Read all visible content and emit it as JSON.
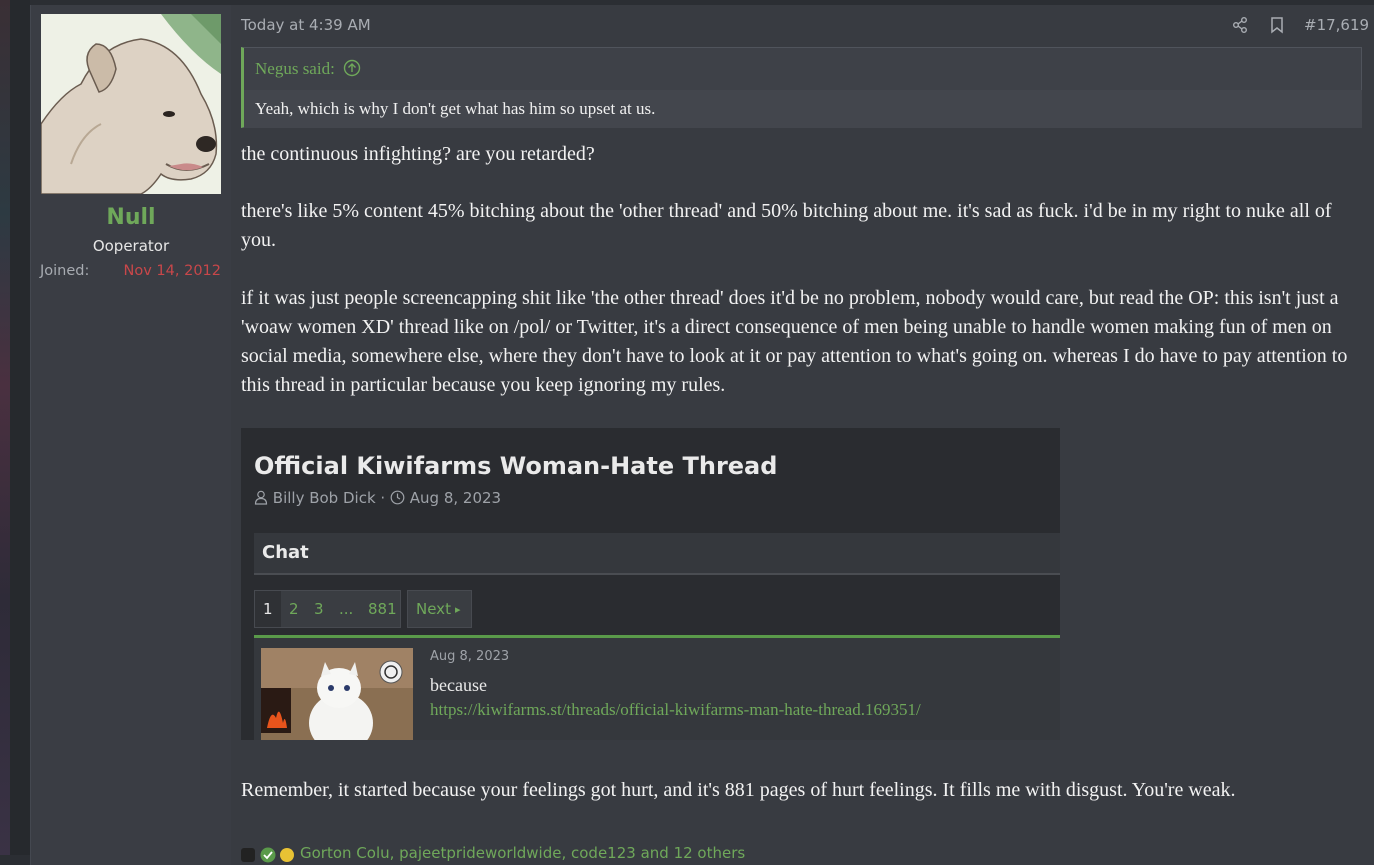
{
  "user": {
    "name": "Null",
    "title": "Ooperator",
    "joined_label": "Joined:",
    "joined_value": "Nov 14, 2012"
  },
  "post": {
    "date": "Today at 4:39 AM",
    "number": "#17,619",
    "quote": {
      "author": "Negus said:",
      "text": "Yeah, which is why I don't get what has him so upset at us."
    },
    "paragraphs": [
      "the continuous infighting? are you retarded?",
      "there's like 5% content 45% bitching about the 'other thread' and 50% bitching about me. it's sad as fuck. i'd be in my right to nuke all of you.",
      "if it was just people screencapping shit like 'the other thread' does it'd be no problem, nobody would care, but read the OP: this isn't just a 'woaw women XD' thread like on /pol/ or Twitter, it's a direct consequence of men being unable to handle women making fun of men on social media, somewhere else, where they don't have to look at it or pay attention to what's going on. whereas I do have to pay attention to this thread in particular because you keep ignoring my rules.",
      "Remember, it started because your feelings got hurt, and it's 881 pages of hurt feelings. It fills me with disgust. You're weak."
    ],
    "reactions_text": "Gorton Colu, pajeetprideworldwide, code123 and 12 others"
  },
  "screenshot": {
    "thread_title": "Official Kiwifarms Woman-Hate Thread",
    "author": "Billy Bob Dick",
    "separator": "·",
    "date": "Aug 8, 2023",
    "forum": "Chat",
    "pages": [
      "1",
      "2",
      "3",
      "...",
      "881"
    ],
    "next_label": "Next",
    "next_arrow": "▸",
    "first_post": {
      "date": "Aug 8, 2023",
      "text": "because",
      "link": "https://kiwifarms.st/threads/official-kiwifarms-man-hate-thread.169351/"
    }
  },
  "colors": {
    "accent": "#6fa85a",
    "joined": "#c8474a",
    "background": "#383b41"
  }
}
